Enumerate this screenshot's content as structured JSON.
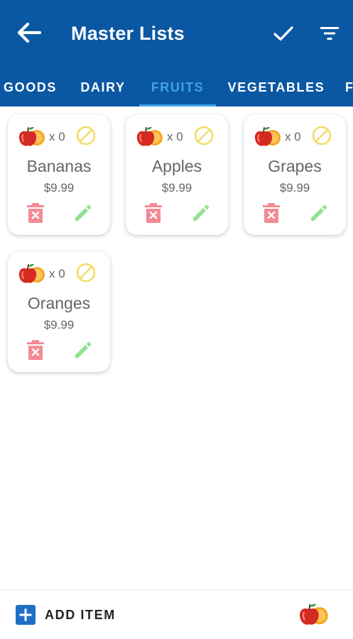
{
  "header": {
    "title": "Master Lists",
    "back_icon": "arrow-left-icon",
    "confirm_icon": "check-icon",
    "filter_icon": "filter-list-icon",
    "background_color": "#0a57a3"
  },
  "tabs": [
    {
      "label": "GOODS",
      "active": false
    },
    {
      "label": "DAIRY",
      "active": false
    },
    {
      "label": "FRUITS",
      "active": true
    },
    {
      "label": "VEGETABLES",
      "active": false
    },
    {
      "label": "F",
      "active": false
    }
  ],
  "items": [
    {
      "name": "Bananas",
      "quantity": "x 0",
      "price": "$9.99"
    },
    {
      "name": "Apples",
      "quantity": "x 0",
      "price": "$9.99"
    },
    {
      "name": "Grapes",
      "quantity": "x 0",
      "price": "$9.99"
    },
    {
      "name": "Oranges",
      "quantity": "x 0",
      "price": "$9.99"
    }
  ],
  "item_icons": {
    "category": "apple-orange-icon",
    "block": "block-icon",
    "delete": "trash-icon",
    "edit": "pencil-icon"
  },
  "colors": {
    "active_tab": "#3ea3e6",
    "delete": "#f28b93",
    "edit": "#8fe38f",
    "block": "#f3dc66",
    "add_button": "#1f6fc8"
  },
  "bottom": {
    "add_label": "ADD ITEM",
    "add_icon": "plus-box-icon",
    "category_icon": "apple-orange-icon"
  }
}
